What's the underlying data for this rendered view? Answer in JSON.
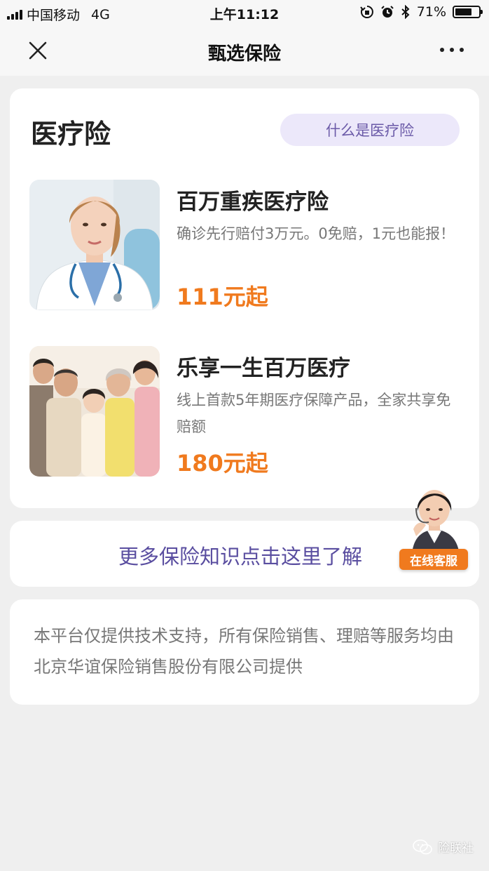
{
  "status_bar": {
    "carrier": "中国移动",
    "network": "4G",
    "time": "上午11:12",
    "battery_percent": "71%",
    "battery_level": 0.71
  },
  "nav": {
    "title": "甄选保险"
  },
  "section": {
    "title": "医疗险",
    "info_button": "什么是医疗险"
  },
  "products": [
    {
      "name": "百万重疾医疗险",
      "description": "确诊先行赔付3万元。0免赔，1元也能报！",
      "price": "111元起"
    },
    {
      "name": "乐享一生百万医疗",
      "description": "线上首款5年期医疗保障产品，全家共享免赔额",
      "price": "180元起"
    }
  ],
  "more_link": "更多保险知识点击这里了解",
  "customer_service": "在线客服",
  "disclaimer": "本平台仅提供技术支持，所有保险销售、理赔等服务均由北京华谊保险销售股份有限公司提供",
  "watermark": "险联社",
  "colors": {
    "accent_orange": "#f07a1e",
    "accent_purple": "#5a4ea0",
    "info_button_bg": "#ece8fa",
    "page_bg": "#efefef"
  },
  "icons": {
    "close": "close-icon",
    "more": "more-dots-icon",
    "signal": "signal-bars-icon",
    "battery": "battery-icon",
    "bluetooth": "bluetooth-icon",
    "alarm": "alarm-icon",
    "rotation_lock": "rotation-lock-icon",
    "wechat": "wechat-icon"
  }
}
